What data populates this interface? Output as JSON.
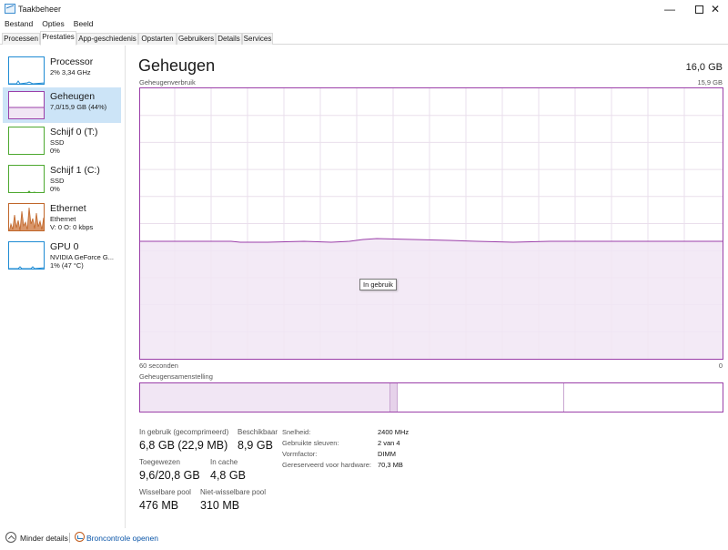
{
  "window": {
    "title": "Taakbeheer",
    "minimize": "—",
    "close": "✕"
  },
  "menu": [
    "Bestand",
    "Opties",
    "Beeld"
  ],
  "tabs": [
    "Processen",
    "Prestaties",
    "App-geschiedenis",
    "Opstarten",
    "Gebruikers",
    "Details",
    "Services"
  ],
  "active_tab": "Prestaties",
  "sidebar": {
    "items": [
      {
        "title": "Processor",
        "sub1": "2% 3,34 GHz",
        "sub2": "",
        "sub3": "",
        "color": "#1e8bd4",
        "icon": "cpu-graph-icon"
      },
      {
        "title": "Geheugen",
        "sub1": "7,0/15,9 GB (44%)",
        "sub2": "",
        "sub3": "",
        "color": "#9b3fa9",
        "icon": "memory-graph-icon"
      },
      {
        "title": "Schijf 0 (T:)",
        "sub1": "SSD",
        "sub2": "0%",
        "sub3": "",
        "color": "#4da82f",
        "icon": "disk-graph-icon"
      },
      {
        "title": "Schijf 1 (C:)",
        "sub1": "SSD",
        "sub2": "0%",
        "sub3": "",
        "color": "#4da82f",
        "icon": "disk-graph-icon"
      },
      {
        "title": "Ethernet",
        "sub1": "Ethernet",
        "sub2": "V: 0 O: 0 kbps",
        "sub3": "",
        "color": "#c0662a",
        "icon": "network-graph-icon"
      },
      {
        "title": "GPU 0",
        "sub1": "NVIDIA GeForce G...",
        "sub2": "1% (47 °C)",
        "sub3": "",
        "color": "#1e8bd4",
        "icon": "gpu-graph-icon"
      }
    ]
  },
  "main": {
    "title": "Geheugen",
    "total": "16,0 GB",
    "usage_label": "Geheugenverbruik",
    "usage_max": "15,9 GB",
    "time_left": "60 seconden",
    "time_right": "0",
    "tooltip": "In gebruik",
    "composition_label": "Geheugensamenstelling",
    "usage_fraction": 0.44
  },
  "stats": {
    "in_use_label": "In gebruik (gecomprimeerd)",
    "in_use_value": "6,8 GB (22,9 MB)",
    "available_label": "Beschikbaar",
    "available_value": "8,9 GB",
    "committed_label": "Toegewezen",
    "committed_value": "9,6/20,8 GB",
    "cached_label": "In cache",
    "cached_value": "4,8 GB",
    "paged_label": "Wisselbare pool",
    "paged_value": "476 MB",
    "nonpaged_label": "Niet-wisselbare pool",
    "nonpaged_value": "310 MB"
  },
  "details": [
    {
      "label": "Snelheid:",
      "value": "2400 MHz"
    },
    {
      "label": "Gebruikte sleuven:",
      "value": "2 van 4"
    },
    {
      "label": "Vormfactor:",
      "value": "DIMM"
    },
    {
      "label": "Gereserveerd voor hardware:",
      "value": "70,3 MB"
    }
  ],
  "footer": {
    "less_details": "Minder details",
    "resource_monitor": "Broncontrole openen"
  }
}
